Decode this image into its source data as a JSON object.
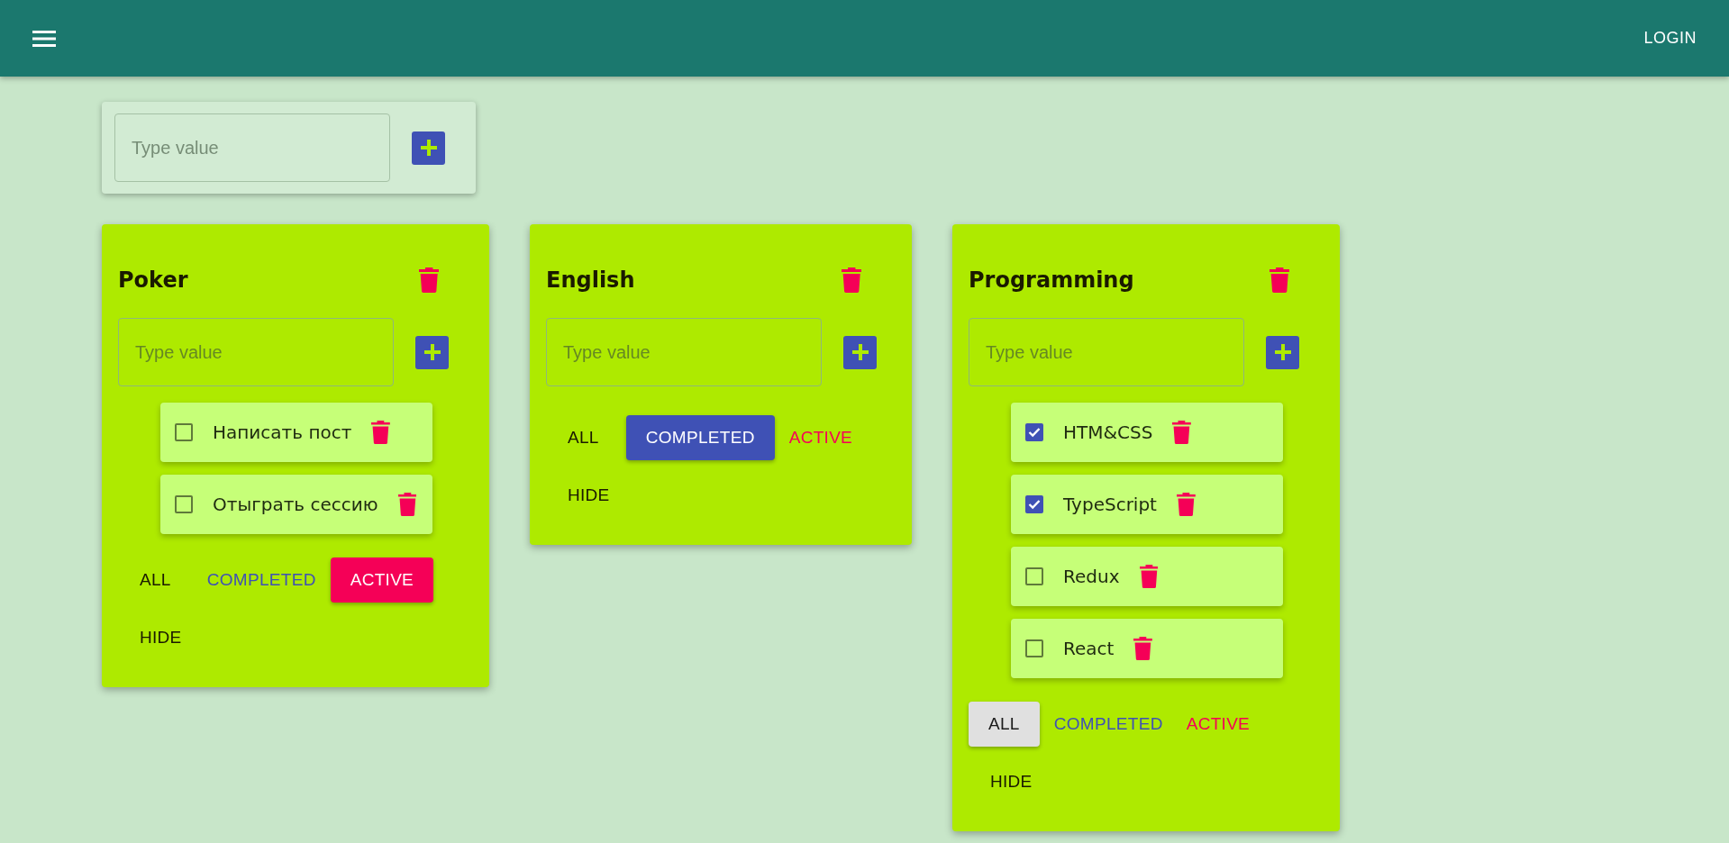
{
  "header": {
    "login": "LOGIN"
  },
  "add_list": {
    "placeholder": "Type value"
  },
  "lists": [
    {
      "title": "Poker",
      "placeholder": "Type value",
      "tasks": [
        {
          "title": "Написать пост",
          "checked": false
        },
        {
          "title": "Отыграть сессию",
          "checked": false
        }
      ],
      "filters": [
        {
          "kind": "all",
          "label": "ALL",
          "selected": false
        },
        {
          "kind": "completed",
          "label": "COMPLETED",
          "selected": false
        },
        {
          "kind": "active",
          "label": "ACTIVE",
          "selected": true
        }
      ],
      "hide": "HIDE"
    },
    {
      "title": "English",
      "placeholder": "Type value",
      "filters": [
        {
          "kind": "all",
          "label": "ALL",
          "selected": false
        },
        {
          "kind": "completed",
          "label": "COMPLETED",
          "selected": true
        },
        {
          "kind": "active",
          "label": "ACTIVE",
          "selected": false
        }
      ],
      "hide": "HIDE"
    },
    {
      "title": "Programming",
      "placeholder": "Type value",
      "tasks": [
        {
          "title": "HTM&CSS",
          "checked": true
        },
        {
          "title": "TypeScript",
          "checked": true
        },
        {
          "title": "Redux",
          "checked": false
        },
        {
          "title": "React",
          "checked": false
        }
      ],
      "filters": [
        {
          "kind": "all",
          "label": "ALL",
          "selected": true
        },
        {
          "kind": "completed",
          "label": "COMPLETED",
          "selected": false
        },
        {
          "kind": "active",
          "label": "ACTIVE",
          "selected": false
        }
      ],
      "hide": "HIDE"
    }
  ]
}
